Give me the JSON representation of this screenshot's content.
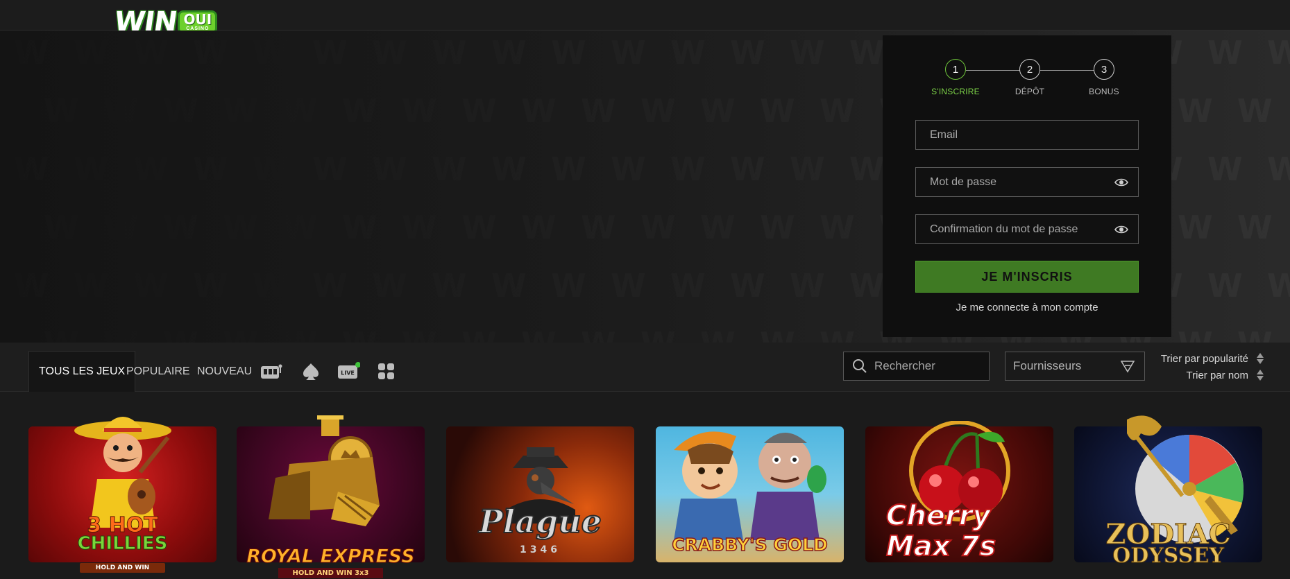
{
  "header": {
    "logo_word": "WIN",
    "logo_badge": "OUI",
    "logo_sub": "CASINO"
  },
  "signup": {
    "steps": [
      {
        "num": "1",
        "label": "S'INSCRIRE",
        "active": true
      },
      {
        "num": "2",
        "label": "DÉPÔT",
        "active": false
      },
      {
        "num": "3",
        "label": "BONUS",
        "active": false
      }
    ],
    "email_placeholder": "Email",
    "password_placeholder": "Mot de passe",
    "confirm_placeholder": "Confirmation du mot de passe",
    "submit_label": "JE M'INSCRIS",
    "login_link": "Je me connecte à mon compte"
  },
  "gamenav": {
    "tabs": [
      "TOUS LES JEUX",
      "POPULAIRE",
      "NOUVEAU"
    ],
    "icons": [
      "slot-machine-icon",
      "spade-icon",
      "live-icon",
      "grid-icon"
    ],
    "live_badge": "LIVE",
    "search_placeholder": "Rechercher",
    "providers_label": "Fournisseurs",
    "sort_popularity": "Trier par popularité",
    "sort_name": "Trier par nom"
  },
  "games": [
    {
      "line1": "3 HOT",
      "line2": "CHILLIES",
      "sub": "HOLD AND WIN"
    },
    {
      "line1": "ROYAL EXPRESS",
      "line2": "",
      "sub": "HOLD AND WIN 3x3"
    },
    {
      "line1": "Plague",
      "line2": "",
      "sub": "1346"
    },
    {
      "line1": "CRABBY'S GOLD",
      "line2": "",
      "sub": ""
    },
    {
      "line1": "Cherry",
      "line2": "Max 7s",
      "sub": ""
    },
    {
      "line1": "ZODIAC",
      "line2": "ODYSSEY",
      "sub": ""
    }
  ],
  "colors": {
    "accent_green": "#6ec43a",
    "cta_green": "#3f7a23",
    "panel_bg": "#0f0f0f"
  }
}
